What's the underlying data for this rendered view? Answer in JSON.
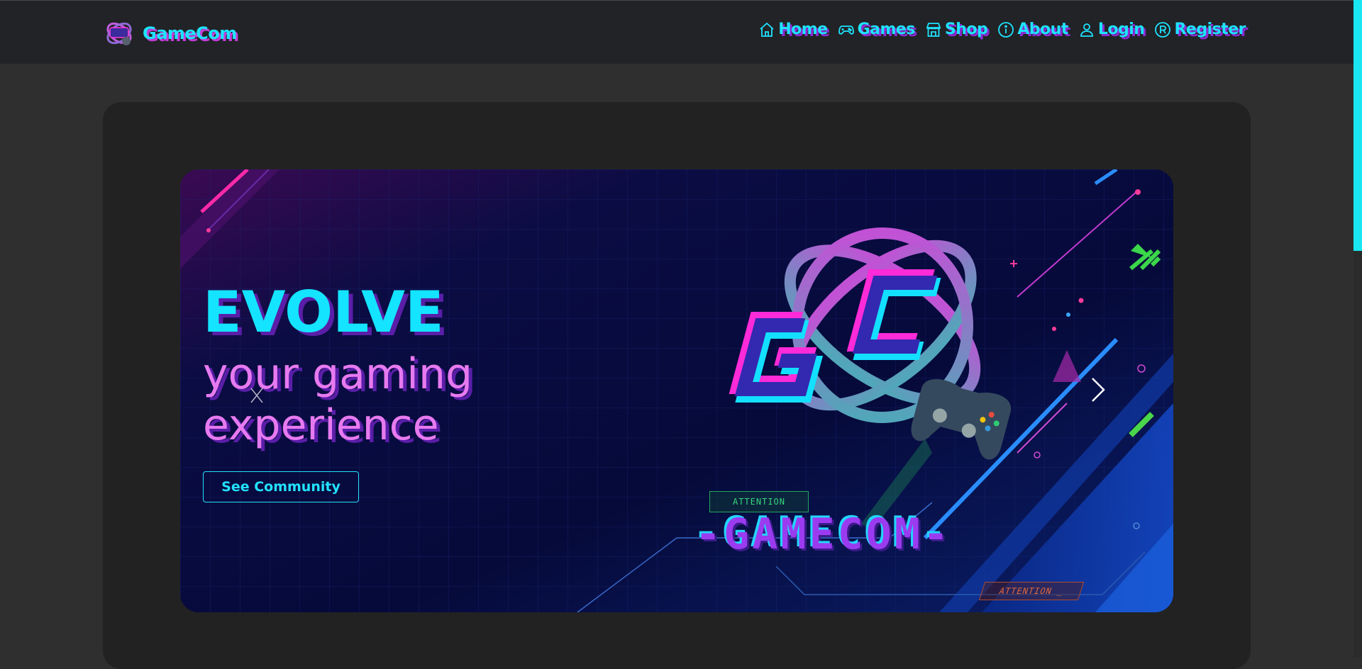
{
  "header": {
    "brand": "GameCom",
    "nav": [
      {
        "label": "Home",
        "icon": "home-icon"
      },
      {
        "label": "Games",
        "icon": "gamepad-icon"
      },
      {
        "label": "Shop",
        "icon": "store-icon"
      },
      {
        "label": "About",
        "icon": "info-icon"
      },
      {
        "label": "Login",
        "icon": "user-icon"
      },
      {
        "label": "Register",
        "icon": "registered-icon"
      }
    ]
  },
  "hero": {
    "headline": "EVOLVE",
    "subline": "your gaming experience",
    "cta_label": "See Community",
    "wordmark": "-GAMECOM-",
    "attention_green": "ATTENTION",
    "attention_orange": "ATTENTION _"
  },
  "colors": {
    "accent_cyan": "#1ee3ff",
    "accent_magenta": "#e77af0",
    "navbar_bg": "#212326",
    "page_bg": "#2f2f2f",
    "card_bg": "#222222"
  }
}
